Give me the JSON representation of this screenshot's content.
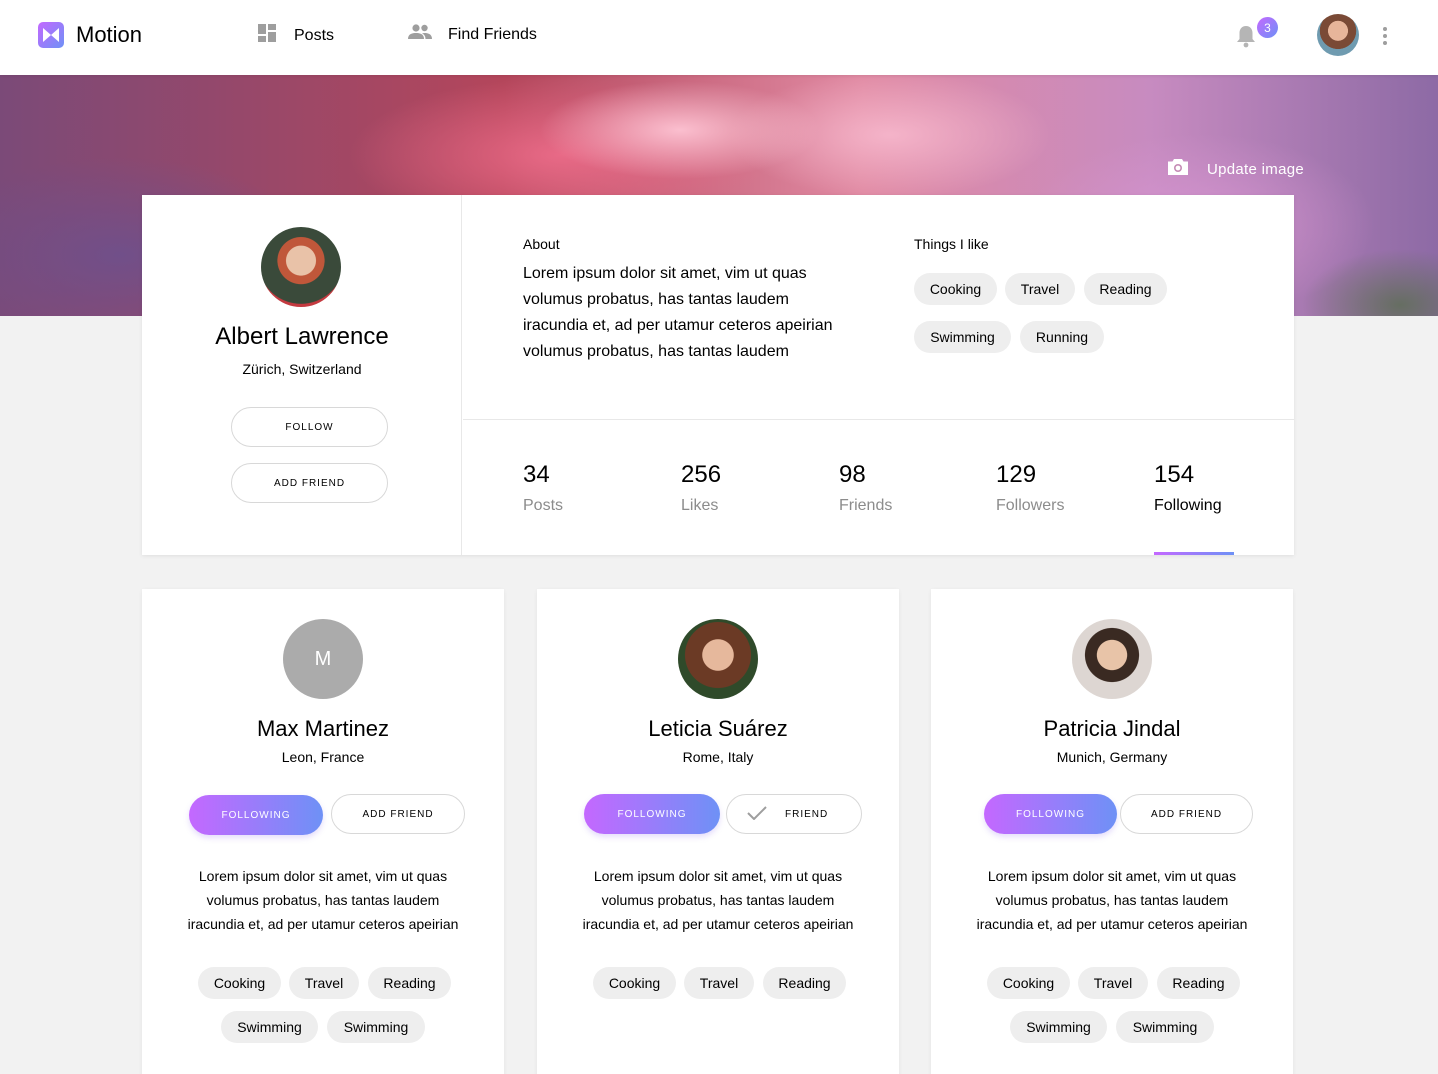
{
  "app": {
    "name": "Motion"
  },
  "nav": {
    "posts": "Posts",
    "find_friends": "Find Friends",
    "notification_count": "3"
  },
  "banner": {
    "update_image": "Update image"
  },
  "profile": {
    "name": "Albert Lawrence",
    "location": "Zürich, Switzerland",
    "follow": "FOLLOW",
    "add_friend": "ADD FRIEND",
    "about_heading": "About",
    "about_text": "Lorem ipsum dolor sit amet, vim ut quas volumus probatus, has tantas laudem iracundia et, ad per utamur ceteros apeirian volumus probatus, has tantas laudem",
    "likes_heading": "Things I like",
    "likes": [
      "Cooking",
      "Travel",
      "Reading",
      "Swimming",
      "Running"
    ],
    "stats": [
      {
        "value": "34",
        "label": "Posts"
      },
      {
        "value": "256",
        "label": "Likes"
      },
      {
        "value": "98",
        "label": "Friends"
      },
      {
        "value": "129",
        "label": "Followers"
      },
      {
        "value": "154",
        "label": "Following"
      }
    ],
    "active_stat": "Following"
  },
  "friends": [
    {
      "initial": "M",
      "name": "Max Martinez",
      "location": "Leon, France",
      "primary": "FOLLOWING",
      "secondary": "ADD FRIEND",
      "text": "Lorem ipsum dolor sit amet, vim ut quas volumus probatus, has tantas laudem iracundia et, ad per utamur ceteros apeirian",
      "tags": [
        "Cooking",
        "Travel",
        "Reading",
        "Swimming",
        "Swimming"
      ]
    },
    {
      "name": "Leticia Suárez",
      "location": "Rome, Italy",
      "primary": "FOLLOWING",
      "secondary": "FRIEND",
      "text": "Lorem ipsum dolor sit amet, vim ut quas volumus probatus, has tantas laudem iracundia et, ad per utamur ceteros apeirian",
      "tags": [
        "Cooking",
        "Travel",
        "Reading"
      ]
    },
    {
      "name": "Patricia Jindal",
      "location": "Munich, Germany",
      "primary": "FOLLOWING",
      "secondary": "ADD FRIEND",
      "text": "Lorem ipsum dolor sit amet, vim ut quas volumus probatus, has tantas laudem iracundia et, ad per utamur ceteros apeirian",
      "tags": [
        "Cooking",
        "Travel",
        "Reading",
        "Swimming",
        "Swimming"
      ]
    }
  ],
  "colors": {
    "accent_start": "#c468ff",
    "accent_end": "#6e91f6",
    "background": "#f2f2f2"
  },
  "icons": {
    "logo": "motion-logo-icon",
    "posts": "dashboard-icon",
    "friends": "people-icon",
    "bell": "bell-icon",
    "camera": "camera-icon",
    "menu": "more-vert-icon",
    "check": "check-icon"
  }
}
